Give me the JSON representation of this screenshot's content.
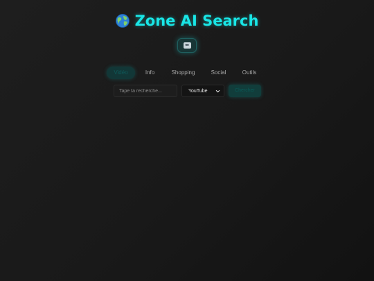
{
  "header": {
    "title": "Zone AI Search",
    "icon": "globe-icon"
  },
  "back_button": {
    "icon": "back-arrow-icon",
    "glyph": "⬅"
  },
  "tabs": [
    {
      "label": "Vidéo",
      "active": true
    },
    {
      "label": "Info",
      "active": false
    },
    {
      "label": "Shopping",
      "active": false
    },
    {
      "label": "Social",
      "active": false
    },
    {
      "label": "Outils",
      "active": false
    }
  ],
  "search": {
    "placeholder": "Tape ta recherche...",
    "value": "",
    "engine_selected": "YouTube",
    "button_label": "Chercher"
  },
  "colors": {
    "accent": "#19e6e6",
    "background": "#1a1a1a",
    "active_tab_bg": "#123737"
  }
}
